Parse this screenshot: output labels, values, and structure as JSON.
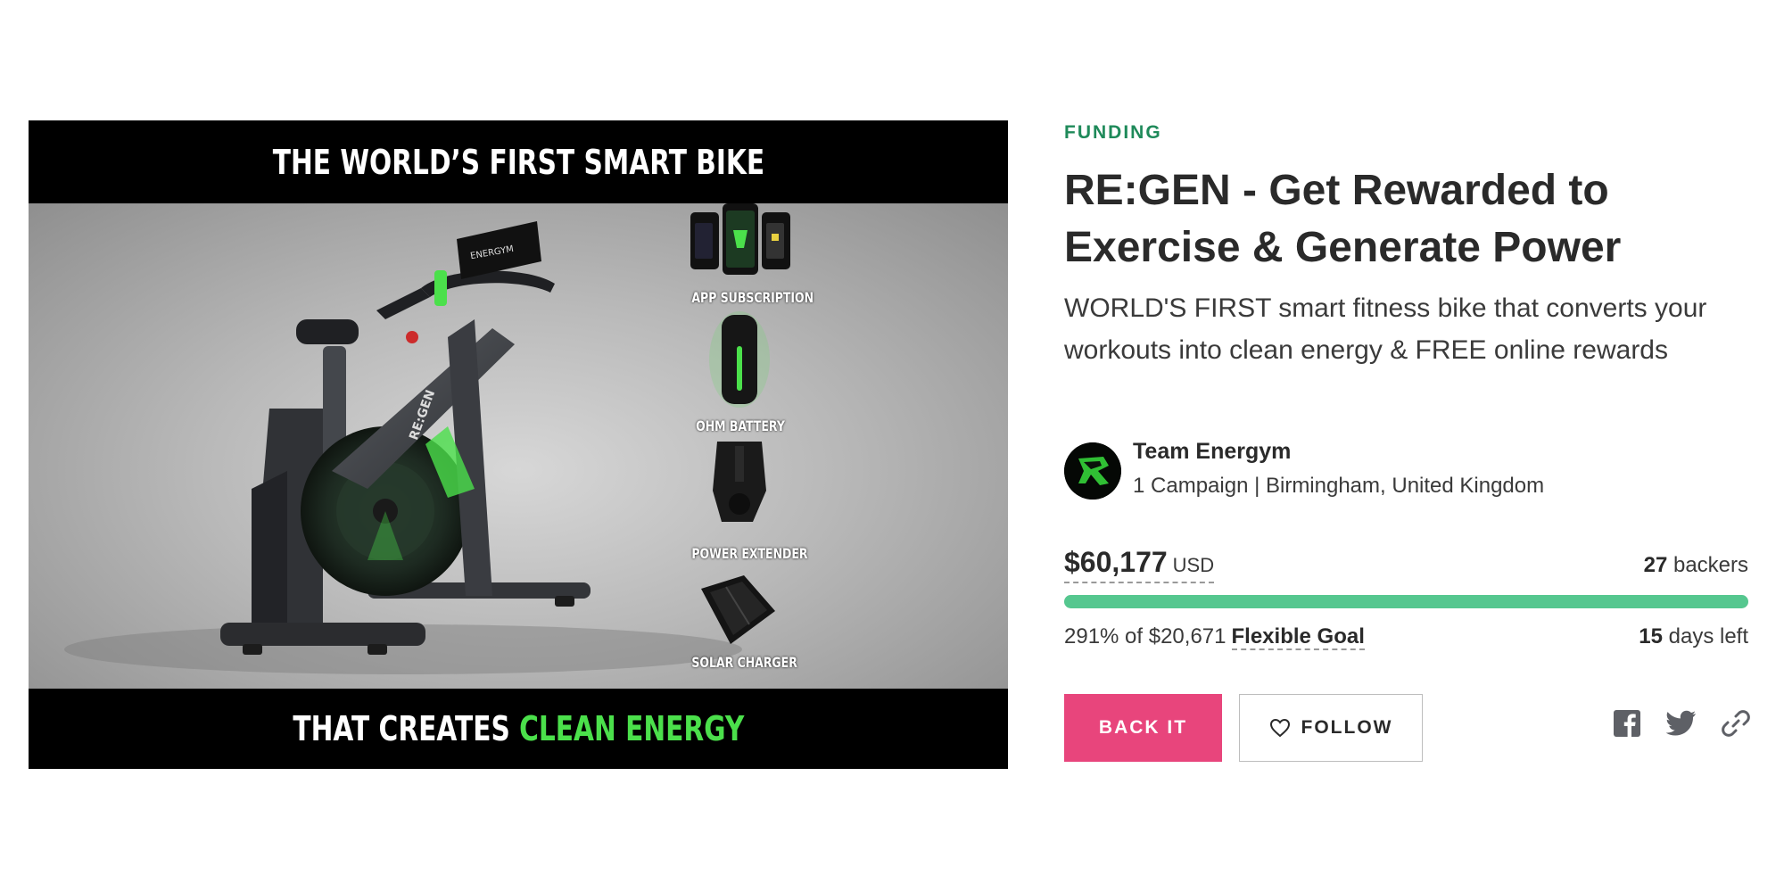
{
  "hero": {
    "headline": "THE WORLD’S FIRST SMART BIKE",
    "footer_white": "THAT CREATES ",
    "footer_green": "CLEAN ENERGY",
    "items": [
      "APP SUBSCRIPTION",
      "OHM BATTERY",
      "POWER EXTENDER",
      "SOLAR CHARGER"
    ],
    "bike_brand": "RE:GEN",
    "screen_brand": "ENERGYM"
  },
  "campaign": {
    "status": "FUNDING",
    "title": "RE:GEN - Get Rewarded to Exercise & Generate Power",
    "tagline": "WORLD'S FIRST smart fitness bike that converts your workouts into clean energy & FREE online rewards"
  },
  "owner": {
    "name": "Team Energym",
    "meta": "1 Campaign | Birmingham, United Kingdom"
  },
  "funding": {
    "amount": "$60,177",
    "currency": "USD",
    "backers_count": "27",
    "backers_label": " backers",
    "progress_fraction": 1.0,
    "goal_text": "291% of $20,671",
    "goal_type": "Flexible Goal",
    "days_count": "15",
    "days_label": " days left"
  },
  "actions": {
    "back_label": "BACK IT",
    "follow_label": "FOLLOW"
  },
  "colors": {
    "accent": "#e8457c",
    "status": "#1f8a5a",
    "progress": "#55c78f",
    "clean_energy": "#4be04b"
  },
  "icons": [
    "heart-icon",
    "facebook-icon",
    "twitter-icon",
    "link-icon"
  ]
}
